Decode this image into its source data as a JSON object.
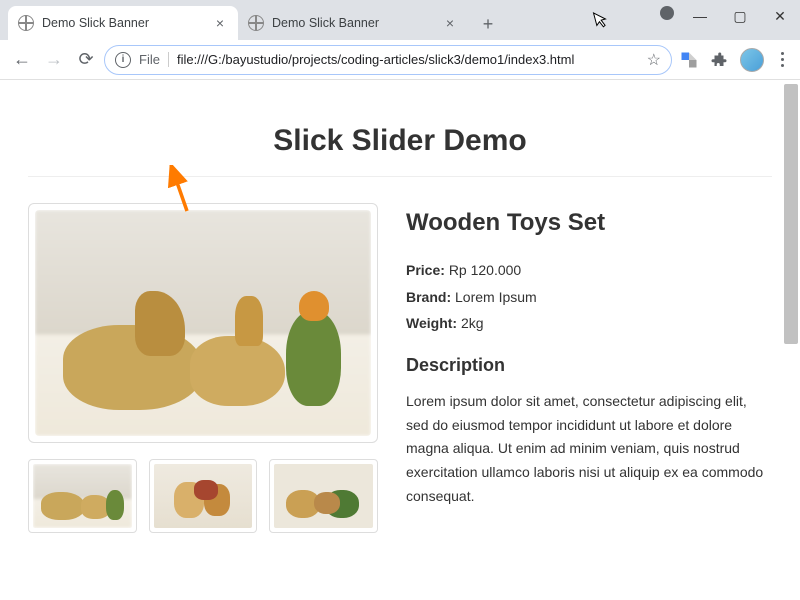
{
  "tabs": [
    {
      "title": "Demo Slick Banner",
      "active": true
    },
    {
      "title": "Demo Slick Banner",
      "active": false
    }
  ],
  "address": {
    "scheme": "File",
    "url": "file:///G:/bayustudio/projects/coding-articles/slick3/demo1/index3.html"
  },
  "page": {
    "heading": "Slick Slider Demo",
    "product": {
      "name": "Wooden Toys Set",
      "price_label": "Price:",
      "price_value": "Rp 120.000",
      "brand_label": "Brand:",
      "brand_value": "Lorem Ipsum",
      "weight_label": "Weight:",
      "weight_value": "2kg",
      "desc_heading": "Description",
      "desc_body": "Lorem ipsum dolor sit amet, consectetur adipiscing elit, sed do eiusmod tempor incididunt ut labore et dolore magna aliqua. Ut enim ad minim veniam, quis nostrud exercitation ullamco laboris nisi ut aliquip ex ea commodo consequat."
    }
  }
}
